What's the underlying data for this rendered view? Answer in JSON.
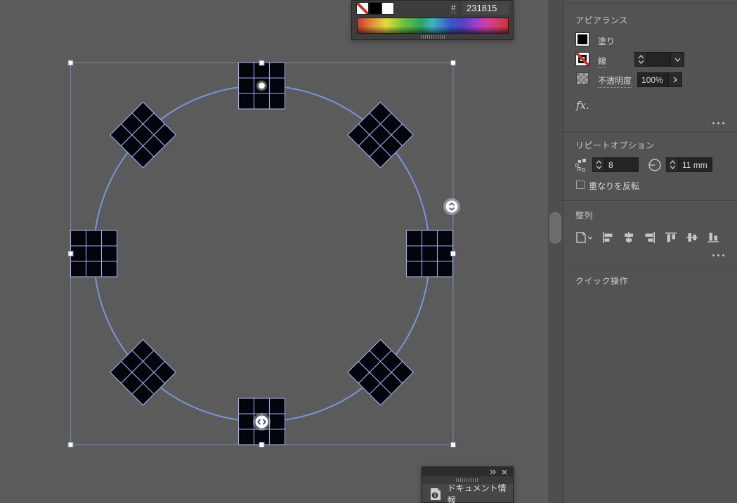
{
  "colors": {
    "selection_blue": "#7d97e0",
    "canvas_bg": "#5b5b5b",
    "panel_bg": "#535353",
    "fill_swatch": "#000000",
    "hex_swatch": "#231815"
  },
  "color_panel": {
    "hex_label": "#",
    "hex_value": "231815",
    "swatches": [
      "none",
      "black",
      "white"
    ]
  },
  "properties_panel": {
    "appearance": {
      "title": "アピアランス",
      "fill_label": "塗り",
      "stroke_label": "線",
      "stroke_weight_value": "",
      "opacity_label": "不透明度",
      "opacity_value": "100%",
      "fx_label": "fx."
    },
    "repeat_options": {
      "title": "リピートオプション",
      "instance_count": "8",
      "radius_value": "11 mm",
      "reverse_overlap_label": "重なりを反転"
    },
    "align": {
      "title": "整列"
    },
    "quick_actions": {
      "title": "クイック操作"
    }
  },
  "document_info_panel": {
    "title": "ドキュメント情報"
  }
}
